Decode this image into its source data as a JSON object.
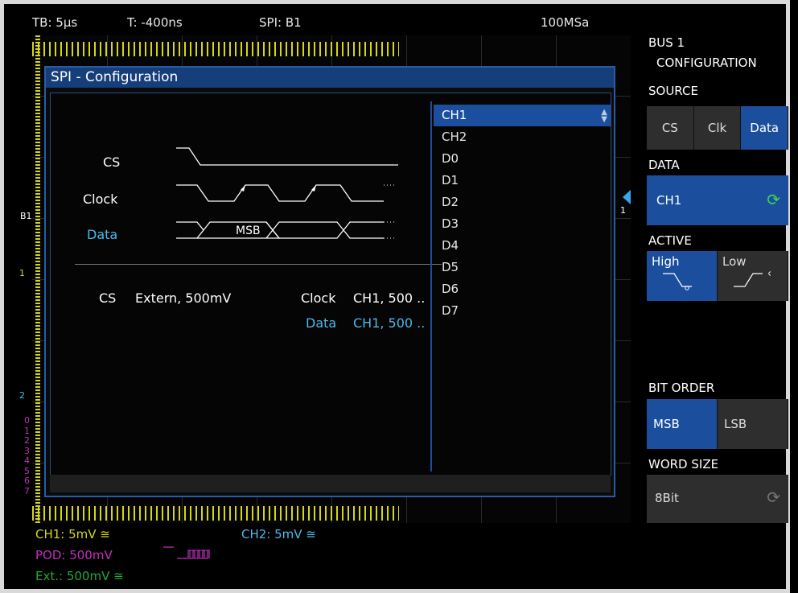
{
  "topbar": {
    "timebase": "TB: 5µs",
    "trigger": "T: -400ns",
    "bus": "SPI: B1",
    "sample_rate": "100MSa"
  },
  "markers": {
    "b1": "B1",
    "one": "1",
    "ch2": "2",
    "ch1": "1"
  },
  "pod_channels": [
    "0",
    "1",
    "2",
    "3",
    "4",
    "5",
    "6",
    "7"
  ],
  "dialog": {
    "title": "SPI - Configuration",
    "signals": {
      "cs": "CS",
      "clock": "Clock",
      "data": "Data",
      "msb": "MSB"
    },
    "summary": {
      "cs_label": "CS",
      "cs_value": "Extern, 500mV",
      "clock_label": "Clock",
      "clock_value": "CH1, 500 ..",
      "data_label": "Data",
      "data_value": "CH1, 500 .."
    },
    "list": [
      "CH1",
      "CH2",
      "D0",
      "D1",
      "D2",
      "D3",
      "D4",
      "D5",
      "D6",
      "D7"
    ],
    "selected": "CH1"
  },
  "sidebar": {
    "title_line1": "BUS 1",
    "title_line2": "CONFIGURATION",
    "source_label": "SOURCE",
    "source_options": [
      "CS",
      "Clk",
      "Data"
    ],
    "source_selected": "Data",
    "data_label": "DATA",
    "data_value": "CH1",
    "active_label": "ACTIVE",
    "active_high": "High",
    "active_low": "Low",
    "bit_order_label": "BIT ORDER",
    "bit_order_msb": "MSB",
    "bit_order_lsb": "LSB",
    "word_size_label": "WORD SIZE",
    "word_size_value": "8Bit"
  },
  "footer": {
    "ch1": "CH1: 5mV ≅",
    "ch2": "CH2: 5mV ≅",
    "pod": "POD: 500mV",
    "ext": "Ext.: 500mV ≅"
  },
  "colors": {
    "ch1": "#d7d51a",
    "ch2": "#4fb9e8",
    "pod": "#c030c0",
    "ext": "#2aa83a",
    "accent": "#1b4f9e"
  }
}
